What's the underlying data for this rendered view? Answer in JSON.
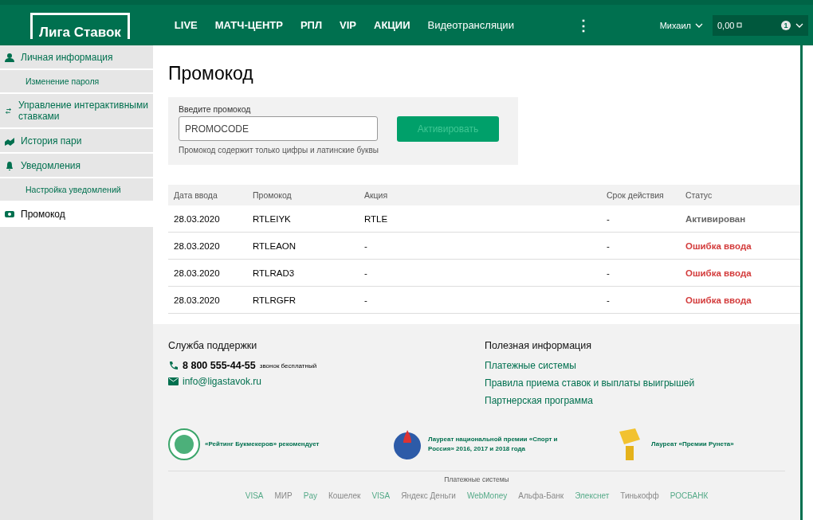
{
  "header": {
    "logo": "Лига Ставок",
    "nav": [
      {
        "label": "LIVE",
        "kind": "bold"
      },
      {
        "label": "МАТЧ-ЦЕНТР",
        "kind": "bold"
      },
      {
        "label": "РПЛ",
        "kind": "bold"
      },
      {
        "label": "VIP",
        "kind": "bold"
      },
      {
        "label": "АКЦИИ",
        "kind": "bold"
      },
      {
        "label": "Видеотрансляции",
        "kind": "plain"
      }
    ],
    "more": "⋮",
    "user": "Михаил",
    "balance": "0,00",
    "badge": "1"
  },
  "sidebar": {
    "items": [
      {
        "label": "Личная информация",
        "selected": false,
        "children": [
          {
            "label": "Изменение пароля",
            "selected": false
          }
        ]
      },
      {
        "label": "Управление интерактивными ставками",
        "selected": false
      },
      {
        "label": "История пари",
        "selected": false
      },
      {
        "label": "Уведомления",
        "selected": false,
        "children": [
          {
            "label": "Настройка уведомлений",
            "selected": false
          }
        ]
      },
      {
        "label": "Промокод",
        "selected": true
      }
    ]
  },
  "page_title": "Промокод",
  "promo_form": {
    "label": "Введите промокод",
    "value": "PROMOCODE",
    "hint": "Промокод содержит только цифры и латинские буквы",
    "button": {
      "label": "Активировать",
      "disabled": true
    }
  },
  "table": {
    "columns": [
      "Дата ввода",
      "Промокод",
      "Акция",
      "Срок действия",
      "Статус"
    ],
    "rows": [
      {
        "cells": [
          "28.03.2020",
          "RTLEIYK",
          "RTLE",
          "-"
        ],
        "status": {
          "text": "Активирован",
          "color": "#666666"
        }
      },
      {
        "cells": [
          "28.03.2020",
          "RTLEAON",
          "-",
          "-"
        ],
        "status": {
          "text": "Ошибка ввода",
          "color": "#d33b3b"
        }
      },
      {
        "cells": [
          "28.03.2020",
          "RTLRAD3",
          "-",
          "-"
        ],
        "status": {
          "text": "Ошибка ввода",
          "color": "#d33b3b"
        }
      },
      {
        "cells": [
          "28.03.2020",
          "RTLRGFR",
          "-",
          "-"
        ],
        "status": {
          "text": "Ошибка ввода",
          "color": "#d33b3b"
        }
      }
    ]
  },
  "footer": {
    "support": {
      "title": "Служба поддержки",
      "phone": "8 800 555-44-55",
      "phone_note": "звонок бесплатный",
      "email": "info@ligastavok.ru"
    },
    "info": {
      "title": "Полезная информация",
      "links": [
        "Платежные системы",
        "Правила приема ставок и выплаты выигрышей",
        "Партнерская программа"
      ]
    },
    "awards": [
      "«Рейтинг Букмекеров» рекомендует",
      "Лауреат национальной премии «Спорт и Россия» 2016, 2017 и 2018 года",
      "Лауреат «Премии Рунета»"
    ],
    "payments_title": "Платежные системы",
    "payments": [
      "VISA",
      "МИР",
      "Pay",
      "Кошелек",
      "VISA",
      "Яндекс Деньги",
      "WebMoney",
      "Альфа-Банк",
      "Элекснет",
      "Тинькофф",
      "РОСБАНК"
    ]
  }
}
